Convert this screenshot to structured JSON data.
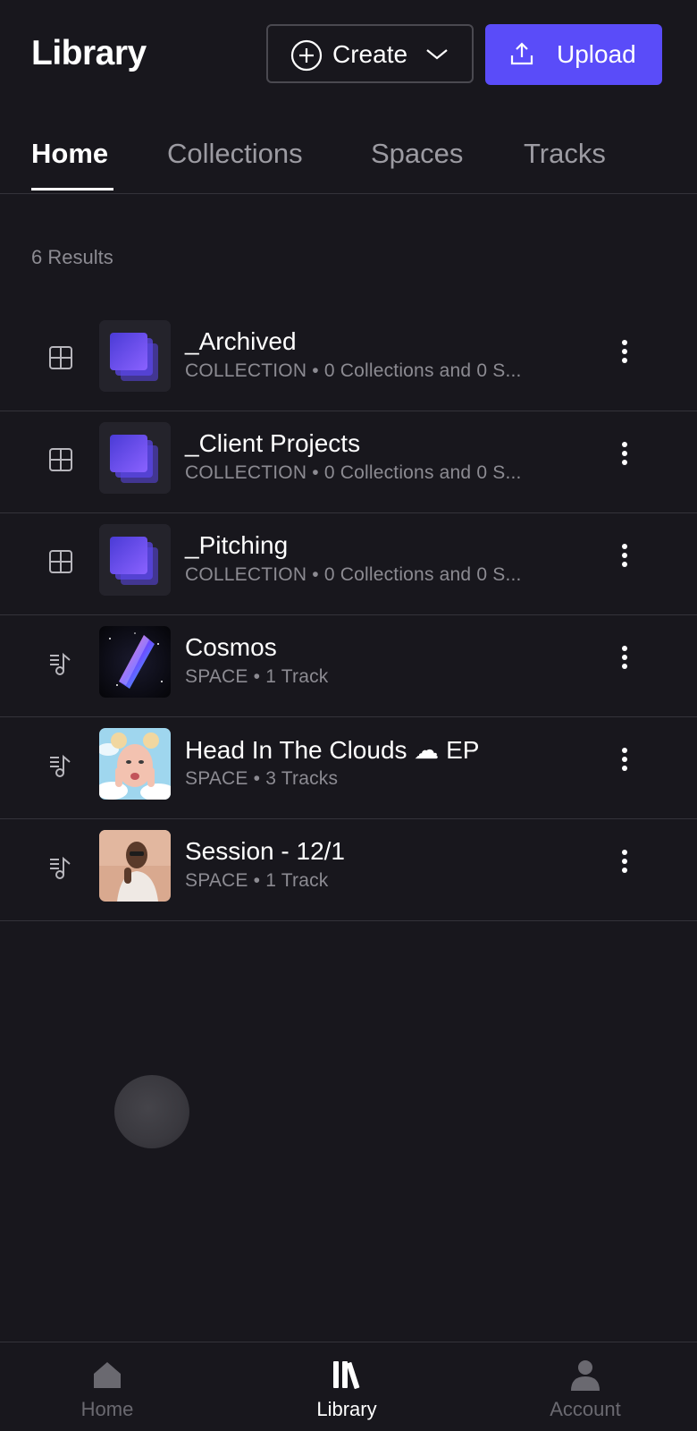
{
  "header": {
    "title": "Library",
    "create_label": "Create",
    "upload_label": "Upload"
  },
  "tabs": [
    {
      "label": "Home",
      "active": true
    },
    {
      "label": "Collections",
      "active": false
    },
    {
      "label": "Spaces",
      "active": false
    },
    {
      "label": "Tracks",
      "active": false
    }
  ],
  "results_text": "6 Results",
  "items": [
    {
      "title": "_Archived",
      "subtitle": "COLLECTION • 0 Collections and 0 S...",
      "type_icon": "grid-icon",
      "thumb": "collection-stack"
    },
    {
      "title": "_Client Projects",
      "subtitle": "COLLECTION • 0 Collections and 0 S...",
      "type_icon": "grid-icon",
      "thumb": "collection-stack"
    },
    {
      "title": "_Pitching",
      "subtitle": "COLLECTION • 0 Collections and 0 S...",
      "type_icon": "grid-icon",
      "thumb": "collection-stack"
    },
    {
      "title": "Cosmos",
      "subtitle": "SPACE • 1 Track",
      "type_icon": "music-list-icon",
      "thumb": "cosmos-art"
    },
    {
      "title": "Head In The Clouds ☁ EP",
      "subtitle": "SPACE • 3 Tracks",
      "type_icon": "music-list-icon",
      "thumb": "portrait-clouds"
    },
    {
      "title": "Session - 12/1",
      "subtitle": "SPACE • 1 Track",
      "type_icon": "music-list-icon",
      "thumb": "portrait-session"
    }
  ],
  "bottom_nav": [
    {
      "label": "Home",
      "icon": "home-icon",
      "active": false
    },
    {
      "label": "Library",
      "icon": "library-icon",
      "active": true
    },
    {
      "label": "Account",
      "icon": "account-icon",
      "active": false
    }
  ],
  "colors": {
    "background": "#18171d",
    "accent": "#5a4cf9",
    "muted_text": "#8c8b92",
    "divider": "#34333a"
  }
}
